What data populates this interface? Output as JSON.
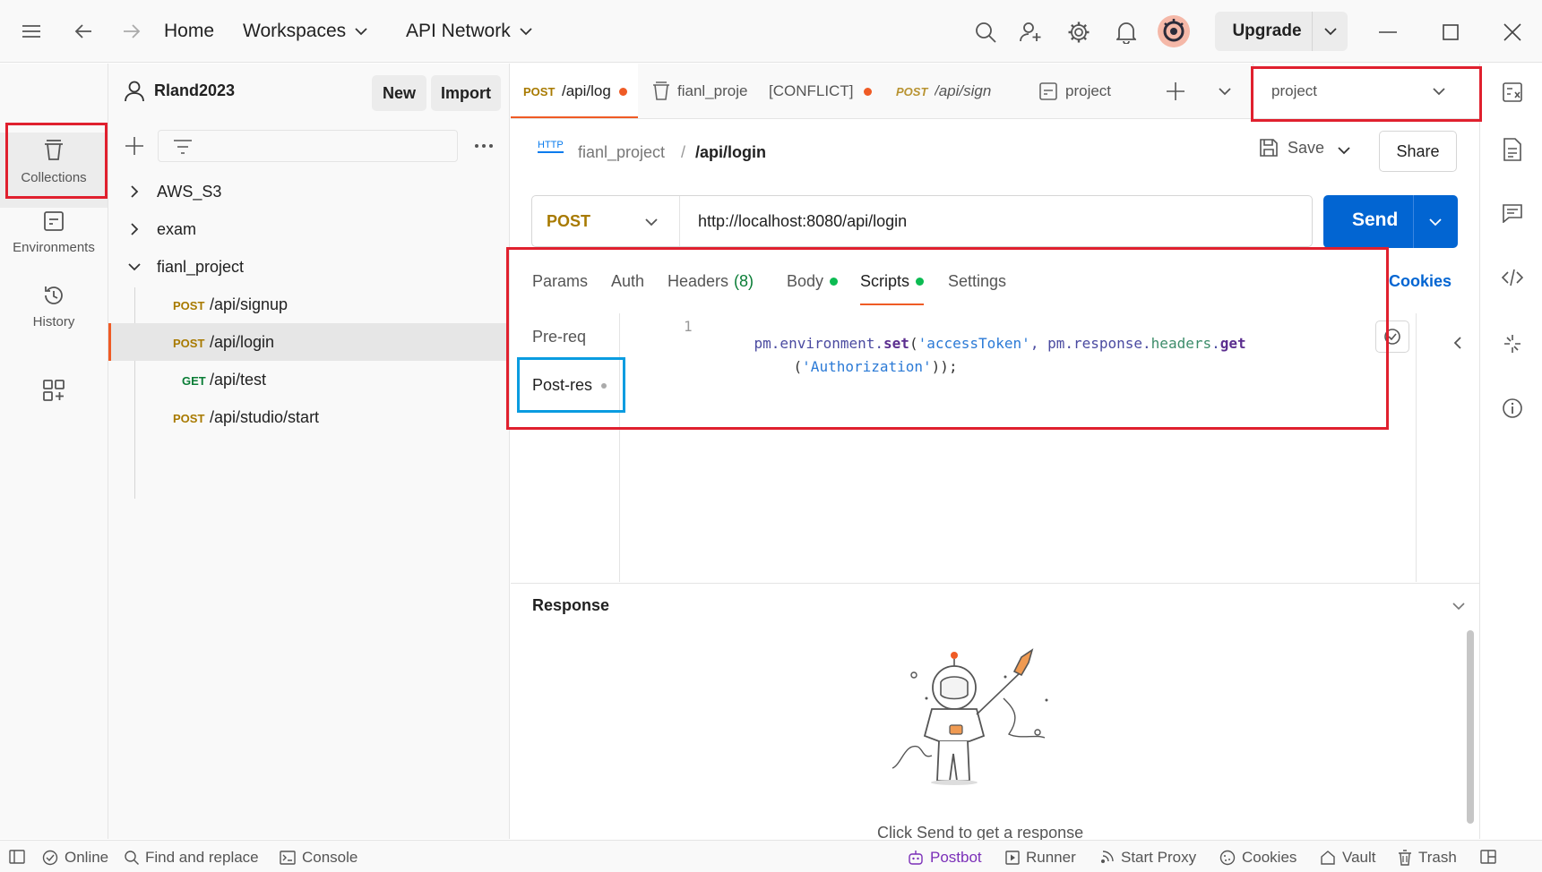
{
  "titlebar": {
    "home": "Home",
    "workspaces": "Workspaces",
    "api_network": "API Network",
    "upgrade": "Upgrade"
  },
  "rail": {
    "collections": "Collections",
    "environments": "Environments",
    "history": "History"
  },
  "sidebar": {
    "user": "Rland2023",
    "new": "New",
    "import": "Import",
    "tree": {
      "c1": "AWS_S3",
      "c2": "exam",
      "c3": "fianl_project",
      "r1_method": "POST",
      "r1_path": "/api/signup",
      "r2_method": "POST",
      "r2_path": "/api/login",
      "r3_method": "GET",
      "r3_path": "/api/test",
      "r4_method": "POST",
      "r4_path": "/api/studio/start"
    }
  },
  "tabs": {
    "t1_method": "POST",
    "t1_label": "/api/log",
    "t2_label": "fianl_proje",
    "t3_label": "[CONFLICT]",
    "t4_method": "POST",
    "t4_label": "/api/sign",
    "t5_label": "project",
    "environment": "project"
  },
  "request": {
    "breadcrumb_collection": "fianl_project",
    "breadcrumb_sep": "/",
    "breadcrumb_request": "/api/login",
    "http_badge": "HTTP",
    "save": "Save",
    "share": "Share",
    "method": "POST",
    "url": "http://localhost:8080/api/login",
    "send": "Send",
    "tabs": {
      "params": "Params",
      "auth": "Auth",
      "headers": "Headers",
      "headers_count": "(8)",
      "body": "Body",
      "scripts": "Scripts",
      "settings": "Settings",
      "cookies": "Cookies"
    },
    "scripts": {
      "pre": "Pre-req",
      "post": "Post-res",
      "line_no": "1",
      "code_line1_a": "pm.environment.",
      "code_line1_b": "set",
      "code_line1_c": "(",
      "code_line1_d": "'accessToken'",
      "code_line1_e": ", pm.response.",
      "code_line1_f": "headers",
      "code_line1_g": ".",
      "code_line1_h": "get",
      "code_line2_a": "(",
      "code_line2_b": "'Authorization'",
      "code_line2_c": "));"
    }
  },
  "response": {
    "title": "Response",
    "empty_text": "Click Send to get a response"
  },
  "status": {
    "online": "Online",
    "find_replace": "Find and replace",
    "console": "Console",
    "postbot": "Postbot",
    "runner": "Runner",
    "start_proxy": "Start Proxy",
    "cookies": "Cookies",
    "vault": "Vault",
    "trash": "Trash"
  },
  "colors": {
    "accent_blue": "#0265d2",
    "post_method": "#a87a00",
    "get_method": "#0a7d36",
    "unsaved_dot": "#ef5b25",
    "active_dot": "#0cbb52",
    "highlight_red": "#e0202e",
    "highlight_blue": "#0a9ce0"
  }
}
